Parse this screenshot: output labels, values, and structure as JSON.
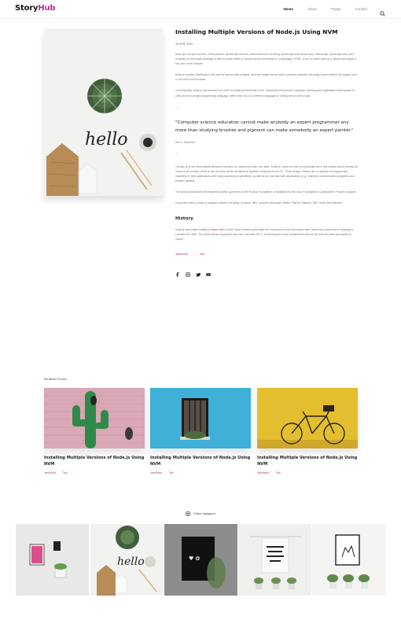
{
  "brand": {
    "logo_main": "Story",
    "logo_accent": "Hub",
    "accent": "#b5307f"
  },
  "nav": {
    "items": [
      "Home",
      "About",
      "Pages",
      "Contact"
    ],
    "active": "Home"
  },
  "article": {
    "title": "Installing Multiple Versions of Node.js Using NVM",
    "date": "30 APR, 2019",
    "paragraphs": [
      "Node.js is an open-source, cross-platform JavaScript run-time environment for executing JavaScript code server-side. Historically, JavaScript was used primarily for client-side scripting, in which scripts written in JavaScript are embedded in a webpage's HTML, to be run client-side by a JavaScript engine in the user's web browser.",
      "Node.js enables JavaScript to be used for server-side scripting, and runs scripts server-side to produce dynamic web page content before the page is sent to the user's web browser.",
      "Consequently, Node.js has become one of the foundational elements of the \"JavaScript everywhere\" paradigm, allowing web application development to unify around a single programming language, rather than rely on a different language for writing server side scripts."
    ],
    "sep1": "----",
    "quote": "\"Computer science education cannot make anybody an expert programmer any more than studying brushes and pigment can make somebody an expert painter.\"",
    "quote_author": "Eric S. Raymond",
    "sep2": "----",
    "paragraphs2": [
      "Though .js is the conventional filename extension for JavaScript code, the name \"Node.js\" does not refer to a particular file in this context and is merely the name of the product. Node.js has an event-driven architecture capable of asynchronous I/O. These design choices aim to optimize throughput and scalability in Web applications with many input/output operations, as well as for real-time Web applications (e.g., real-time communication programs and browser games).",
      "The Node.js distributed development project, governed by the Node.js Foundation, is facilitated by the Linux Foundation's Collaborative Projects program.",
      "Corporate users of Node.js software include GoDaddy, Groupon, IBM, LinkedIn, Microsoft, Netflix, PayPal, Rakuten, SAP, Voxer and Walmart."
    ],
    "history_heading": "History",
    "history_pre": "Node.js was written initially by ",
    "history_link": "Ryan Dahl",
    "history_post": " in 2009, about thirteen years after the introduction of the first server-side JavaScript environment, Netscape's LiveWire Pro Web. The initial release supported only Linux and Mac OS X. Its development and maintenance was led by Dahl and later sponsored by Joyent.",
    "tags": [
      "JavaScript",
      "Tips"
    ],
    "share_icons": [
      "facebook-icon",
      "instagram-icon",
      "twitter-icon",
      "youtube-icon"
    ]
  },
  "related": {
    "heading": "Related Posts",
    "posts": [
      {
        "title": "Installing Multiple Versions of Node.js Using NVM",
        "tags": [
          "JavaScript",
          "Tips"
        ],
        "image": "cactus-mural"
      },
      {
        "title": "Installing Multiple Versions of Node.js Using NVM",
        "tags": [
          "JavaScript",
          "Tips"
        ],
        "image": "blue-window"
      },
      {
        "title": "Installing Multiple Versions of Node.js Using NVM",
        "tags": [
          "JavaScript",
          "Tips"
        ],
        "image": "yellow-bicycle"
      }
    ]
  },
  "instagram": {
    "label": "Follow Instagram",
    "images": [
      "pink-poster",
      "hello-desk",
      "black-frame-plant",
      "hanging-poster",
      "framed-print-plants"
    ]
  }
}
